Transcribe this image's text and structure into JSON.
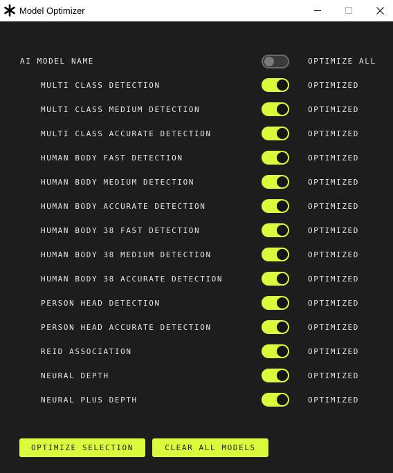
{
  "window": {
    "title": "Model Optimizer"
  },
  "header": {
    "label": "AI MODEL NAME",
    "optimize_all_label": "OPTIMIZE ALL",
    "optimize_all_on": false
  },
  "models": [
    {
      "name": "MULTI CLASS DETECTION",
      "status": "OPTIMIZED",
      "enabled": true
    },
    {
      "name": "MULTI CLASS MEDIUM DETECTION",
      "status": "OPTIMIZED",
      "enabled": true
    },
    {
      "name": "MULTI CLASS ACCURATE DETECTION",
      "status": "OPTIMIZED",
      "enabled": true
    },
    {
      "name": "HUMAN BODY FAST DETECTION",
      "status": "OPTIMIZED",
      "enabled": true
    },
    {
      "name": "HUMAN BODY MEDIUM DETECTION",
      "status": "OPTIMIZED",
      "enabled": true
    },
    {
      "name": "HUMAN BODY ACCURATE DETECTION",
      "status": "OPTIMIZED",
      "enabled": true
    },
    {
      "name": "HUMAN BODY 38 FAST DETECTION",
      "status": "OPTIMIZED",
      "enabled": true
    },
    {
      "name": "HUMAN BODY 38 MEDIUM DETECTION",
      "status": "OPTIMIZED",
      "enabled": true
    },
    {
      "name": "HUMAN BODY 38 ACCURATE DETECTION",
      "status": "OPTIMIZED",
      "enabled": true
    },
    {
      "name": "PERSON HEAD DETECTION",
      "status": "OPTIMIZED",
      "enabled": true
    },
    {
      "name": "PERSON HEAD ACCURATE DETECTION",
      "status": "OPTIMIZED",
      "enabled": true
    },
    {
      "name": "REID ASSOCIATION",
      "status": "OPTIMIZED",
      "enabled": true
    },
    {
      "name": "NEURAL DEPTH",
      "status": "OPTIMIZED",
      "enabled": true
    },
    {
      "name": "NEURAL PLUS DEPTH",
      "status": "OPTIMIZED",
      "enabled": true
    }
  ],
  "actions": {
    "optimize_selection": "OPTIMIZE SELECTION",
    "clear_all_models": "CLEAR ALL MODELS"
  },
  "colors": {
    "accent": "#dcfa3c",
    "background": "#1d1d1d",
    "text": "#e6e6e6"
  }
}
